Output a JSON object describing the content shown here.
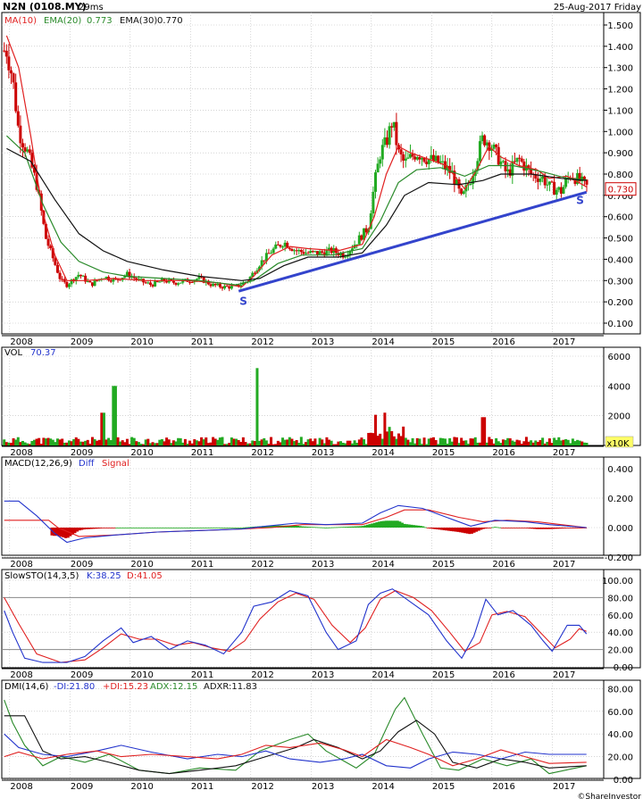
{
  "header": {
    "symbol": "N2N (0108.MY)",
    "render_time": "29ms",
    "date": "25-Aug-2017 Friday",
    "ma_label": "MA(10)",
    "ema20_label": "EMA(20)",
    "ema20_value": "0.773",
    "ema30_label": "EMA(30)",
    "ema30_value": "0.770"
  },
  "colors": {
    "up": "#22aa22",
    "down": "#cc0000",
    "ma10": "#e02020",
    "ema20": "#2a8a2a",
    "ema30": "#111111",
    "trendline": "#3344cc",
    "diff": "#2233cc",
    "signal": "#e02020",
    "grid": "#bbbbbb",
    "price_box": "#cc0000"
  },
  "price_panel": {
    "y_ticks": [
      "1.500",
      "1.400",
      "1.300",
      "1.200",
      "1.100",
      "1.000",
      "0.900",
      "0.800",
      "0.700",
      "0.600",
      "0.500",
      "0.400",
      "0.300",
      "0.200",
      "0.100"
    ],
    "last_price": "0.730",
    "support_labels": [
      "S",
      "S"
    ]
  },
  "volume_panel": {
    "label": "VOL",
    "value": "70.37",
    "y_ticks": [
      "6000",
      "4000",
      "2000"
    ],
    "unit": "x10K"
  },
  "macd_panel": {
    "label": "MACD(12,26,9)",
    "diff_label": "Diff",
    "signal_label": "Signal",
    "y_ticks": [
      "0.400",
      "0.200",
      "0.000",
      "-0.200"
    ]
  },
  "sto_panel": {
    "label": "SlowSTO(14,3,5)",
    "k_label": "K:38.25",
    "d_label": "D:41.05",
    "y_ticks": [
      "100.00",
      "80.00",
      "60.00",
      "40.00",
      "20.00",
      "0.00"
    ]
  },
  "dmi_panel": {
    "label": "DMI(14,6)",
    "minus_di": "-DI:21.80",
    "plus_di": "+DI:15.23",
    "adx": "ADX:12.15",
    "adxr": "ADXR:11.83",
    "y_ticks": [
      "80.00",
      "60.00",
      "40.00",
      "20.00",
      "0.00"
    ]
  },
  "x_axis": {
    "years": [
      "2008",
      "2009",
      "2010",
      "2011",
      "2012",
      "2013",
      "2014",
      "2015",
      "2016",
      "2017"
    ]
  },
  "footer": {
    "credit": "©ShareInvestor"
  },
  "chart_data": {
    "type": "line",
    "title": "N2N (0108.MY)",
    "x": [
      "2008",
      "2008.5",
      "2009",
      "2009.5",
      "2010",
      "2010.5",
      "2011",
      "2011.5",
      "2012",
      "2012.5",
      "2013",
      "2013.5",
      "2014",
      "2014.5",
      "2015",
      "2015.5",
      "2016",
      "2016.5",
      "2017",
      "2017.6"
    ],
    "series": [
      {
        "name": "MA(10)",
        "values": [
          1.45,
          0.98,
          0.29,
          0.31,
          0.32,
          0.3,
          0.3,
          0.28,
          0.28,
          0.44,
          0.46,
          0.44,
          0.72,
          0.92,
          0.86,
          0.75,
          0.94,
          0.85,
          0.78,
          0.74
        ]
      },
      {
        "name": "EMA(20)",
        "values": [
          0.98,
          0.82,
          0.38,
          0.31,
          0.31,
          0.3,
          0.3,
          0.29,
          0.28,
          0.39,
          0.43,
          0.42,
          0.58,
          0.84,
          0.82,
          0.79,
          0.85,
          0.83,
          0.79,
          0.773
        ]
      },
      {
        "name": "EMA(30)",
        "values": [
          0.92,
          0.86,
          0.55,
          0.44,
          0.38,
          0.34,
          0.32,
          0.31,
          0.29,
          0.37,
          0.41,
          0.41,
          0.52,
          0.78,
          0.8,
          0.76,
          0.8,
          0.8,
          0.78,
          0.77
        ]
      }
    ],
    "ylim": [
      0.1,
      1.55
    ],
    "last_price": 0.73,
    "volume_x10K": [
      600,
      300,
      200,
      200,
      2200,
      4000,
      200,
      200,
      300,
      5200,
      300,
      300,
      600,
      2100,
      800,
      300,
      1900,
      500,
      300,
      70.37
    ],
    "macd_ylim": [
      -0.2,
      0.4
    ],
    "slowsto": {
      "K": 38.25,
      "D": 41.05,
      "ylim": [
        0,
        100
      ]
    },
    "dmi": {
      "minus_di": 21.8,
      "plus_di": 15.23,
      "adx": 12.15,
      "adxr": 11.83,
      "ylim": [
        0,
        85
      ]
    }
  }
}
